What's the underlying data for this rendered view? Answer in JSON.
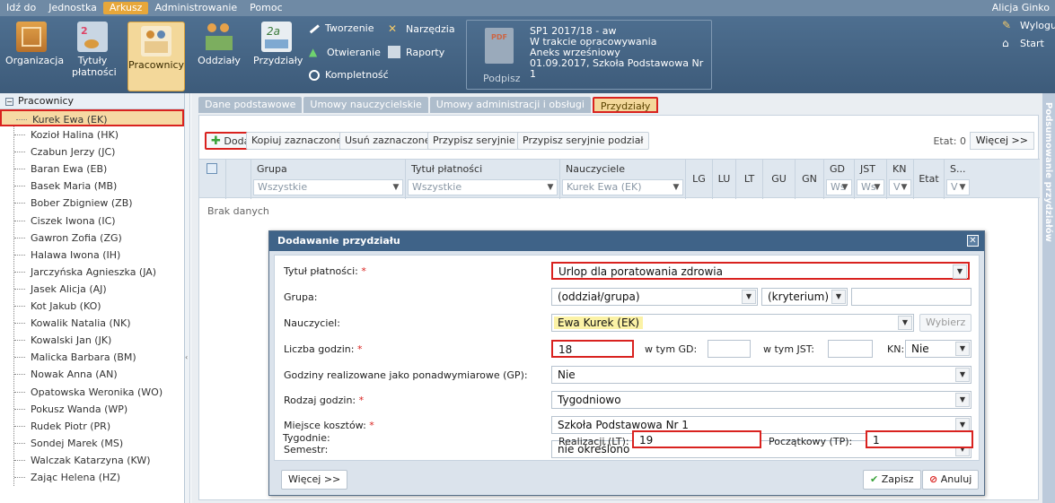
{
  "menu": {
    "items": [
      "Idź do",
      "Jednostka",
      "Arkusz",
      "Administrowanie",
      "Pomoc"
    ],
    "user": "Alicja Ginko"
  },
  "ribbon": {
    "organizacja": "Organizacja",
    "tytuly_1": "Tytuły",
    "tytuly_2": "płatności",
    "pracownicy": "Pracownicy",
    "oddzialy": "Oddziały",
    "przydzialy": "Przydziały",
    "tworzenie": "Tworzenie",
    "otwieranie": "Otwieranie",
    "kompletnosc": "Kompletność",
    "narzedzia": "Narzędzia",
    "raporty": "Raporty",
    "pdf": "PDF",
    "podpisz": "Podpisz",
    "doc_info": [
      "SP1 2017/18 - aw",
      "W trakcie opracowywania",
      "Aneks wrześniowy",
      "01.09.2017, Szkoła Podstawowa Nr 1"
    ],
    "wyloguj": "Wyloguj",
    "start": "Start"
  },
  "left": {
    "root": "Pracownicy",
    "items": [
      "Kurek Ewa (EK)",
      "Kozioł Halina (HK)",
      "Czabun Jerzy (JC)",
      "Baran Ewa (EB)",
      "Basek Maria (MB)",
      "Bober Zbigniew (ZB)",
      "Ciszek Iwona (IC)",
      "Gawron Zofia (ZG)",
      "Halawa Iwona (IH)",
      "Jarczyńska Agnieszka (JA)",
      "Jasek Alicja (AJ)",
      "Kot Jakub (KO)",
      "Kowalik Natalia (NK)",
      "Kowalski Jan (JK)",
      "Malicka Barbara (BM)",
      "Nowak Anna (AN)",
      "Opatowska Weronika (WO)",
      "Pokusz Wanda (WP)",
      "Rudek Piotr (PR)",
      "Sondej Marek (MS)",
      "Walczak Katarzyna (KW)",
      "Zając Helena (HZ)"
    ]
  },
  "rightbar": {
    "label": "Podsumowanie przydziałów"
  },
  "tabs": [
    "Dane podstawowe",
    "Umowy nauczycielskie",
    "Umowy administracji i obsługi",
    "Przydziały"
  ],
  "toolbar": {
    "dodaj": "Dodaj",
    "kopiuj": "Kopiuj zaznaczone",
    "usun": "Usuń zaznaczone",
    "przypisz": "Przypisz seryjnie",
    "przypisz_podzial": "Przypisz seryjnie podział",
    "etat": "Etat: 0",
    "wiecej": "Więcej >>"
  },
  "grid": {
    "grupa": "Grupa",
    "grupa_filter": "Wszystkie",
    "tytul": "Tytuł płatności",
    "tytul_filter": "Wszystkie",
    "nauczyciele": "Nauczyciele",
    "naucz_filter": "Kurek Ewa (EK)",
    "lg": "LG",
    "lu": "LU",
    "lt": "LT",
    "gu": "GU",
    "gn": "GN",
    "gd": "GD",
    "gd_f": "Ws",
    "jst": "JST",
    "jst_f": "Ws",
    "kn": "KN",
    "kn_f": "V",
    "etat": "Etat",
    "s": "S...",
    "s_f": "V",
    "brak": "Brak danych"
  },
  "dialog": {
    "title": "Dodawanie przydziału",
    "tytul_label": "Tytuł płatności:",
    "tytul_value": "Urlop dla poratowania zdrowia",
    "grupa_label": "Grupa:",
    "grupa_value": "(oddział/grupa)",
    "kryterium": "(kryterium)",
    "naucz_label": "Nauczyciel:",
    "naucz_value": "Ewa Kurek (EK)",
    "wybierz": "Wybierz",
    "godz_label": "Liczba godzin:",
    "godz_value": "18",
    "gd_label": "w tym GD:",
    "jst_label": "w tym JST:",
    "kn_label": "KN:",
    "kn_value": "Nie",
    "gp_label": "Godziny realizowane jako ponadwymiarowe (GP):",
    "gp_value": "Nie",
    "rodzaj_label": "Rodzaj godzin:",
    "rodzaj_value": "Tygodniowo",
    "miejsce_label": "Miejsce kosztów:",
    "miejsce_value": "Szkoła Podstawowa Nr 1",
    "semestr_label": "Semestr:",
    "semestr_value": "nie określono",
    "tygodnie_label": "Tygodnie:",
    "lt_label": "Realizacji (LT):",
    "lt_value": "19",
    "tp_label": "Początkowy (TP):",
    "tp_value": "1",
    "wiecej": "Więcej >>",
    "zapisz": "Zapisz",
    "anuluj": "Anuluj"
  }
}
